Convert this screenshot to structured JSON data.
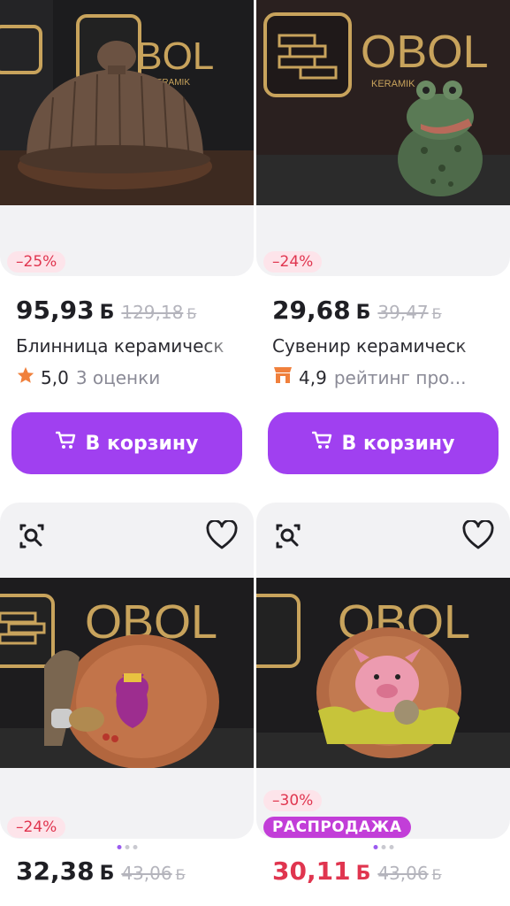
{
  "products": [
    {
      "discount": "–25%",
      "price": "95,93",
      "currency": "Б",
      "old_price": "129,18",
      "old_currency": "Б",
      "title": "Блинница керамическ",
      "rating": "5,0",
      "rating_meta": "3 оценки",
      "rating_icon": "star-icon",
      "cart_label": "В корзину",
      "photo_logo": "OBOL",
      "photo_logo_sub": "KERAMIK"
    },
    {
      "discount": "–24%",
      "price": "29,68",
      "currency": "Б",
      "old_price": "39,47",
      "old_currency": "Б",
      "title": "Сувенир керамическ",
      "rating": "4,9",
      "rating_meta": "рейтинг про...",
      "rating_icon": "shop-icon",
      "cart_label": "В корзину",
      "photo_logo": "OBOL",
      "photo_logo_sub": "KERAMIK"
    },
    {
      "discount": "–24%",
      "price": "32,38",
      "currency": "Б",
      "old_price": "43,06",
      "old_currency": "Б",
      "photo_logo": "OBOL"
    },
    {
      "discount": "–30%",
      "sale_label": "РАСПРОДАЖА",
      "price": "30,11",
      "currency": "Б",
      "old_price": "43,06",
      "old_currency": "Б",
      "photo_logo": "OBOL"
    }
  ],
  "colors": {
    "accent": "#a040f0",
    "discount": "#e0354f",
    "sale_badge": "#c23ed8"
  }
}
